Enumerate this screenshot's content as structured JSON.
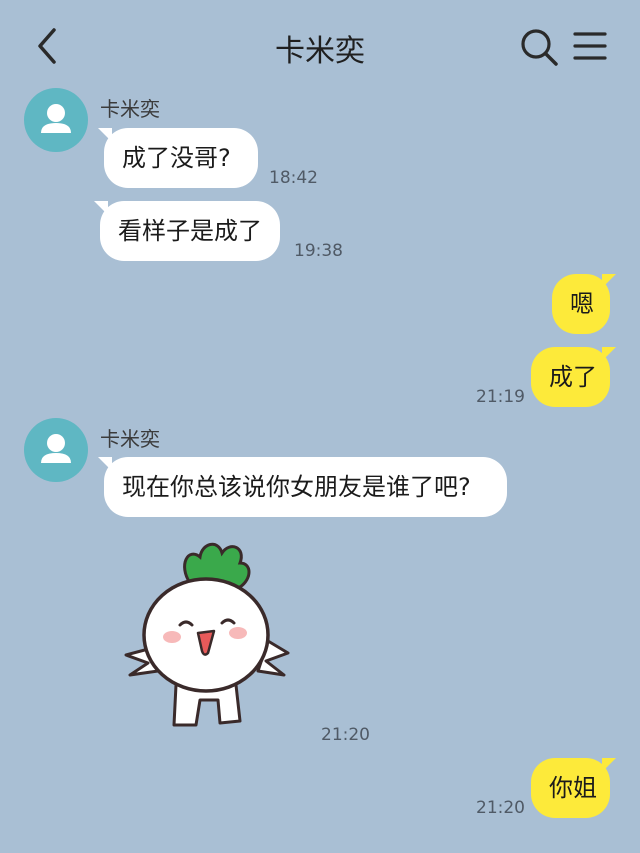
{
  "header": {
    "title": "卡米奕",
    "back_icon": "chevron-left-icon",
    "search_icon": "search-icon",
    "menu_icon": "hamburger-menu-icon"
  },
  "colors": {
    "background": "#a9bfd4",
    "incoming_bubble": "#ffffff",
    "outgoing_bubble": "#fdea3a",
    "avatar": "#5fb7c3"
  },
  "messages": [
    {
      "sender": "卡米奕",
      "text": "成了没哥?",
      "time": "18:42"
    },
    {
      "text": "看样子是成了",
      "time": "19:38"
    },
    {
      "text": "嗯"
    },
    {
      "text": "成了",
      "time": "21:19"
    },
    {
      "sender": "卡米奕",
      "text": "现在你总该说你女朋友是谁了吧?"
    },
    {
      "sticker": "radish-sticker",
      "time": "21:20"
    },
    {
      "text": "你姐",
      "time": "21:20"
    }
  ]
}
